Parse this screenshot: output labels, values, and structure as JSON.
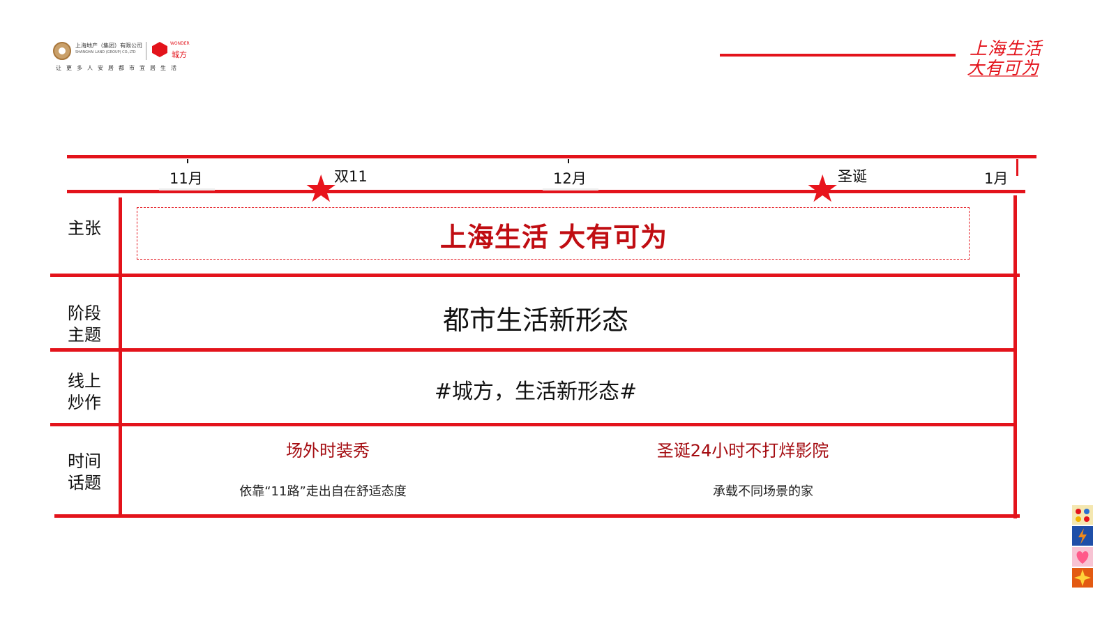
{
  "colors": {
    "accent": "#e3131b",
    "slogan": "#c00d12",
    "topic": "#a40b10"
  },
  "header": {
    "company_cn": "上海地产（集团）有限公司",
    "company_en": "SHANGHAI LAND (GROUP) CO.,LTD",
    "partner_en": "WONDER",
    "partner_cn": "城方",
    "logo_slogan": "让更多人安居都市宜居生活",
    "brand_line1": "上海生活",
    "brand_line2": "大有可为"
  },
  "timeline": {
    "months": [
      "11月",
      "12月",
      "1月"
    ],
    "events": [
      "双11",
      "圣诞"
    ],
    "event_icon": "star-icon"
  },
  "table": {
    "rows": [
      {
        "label": "主张",
        "content": "上海生活  大有可为"
      },
      {
        "label_line1": "阶段",
        "label_line2": "主题",
        "content": "都市生活新形态"
      },
      {
        "label_line1": "线上",
        "label_line2": "炒作",
        "content": "#城方，生活新形态#"
      },
      {
        "label_line1": "时间",
        "label_line2": "话题"
      }
    ],
    "topics": [
      {
        "title": "场外时装秀",
        "desc": "依靠“11路”走出自在舒适态度"
      },
      {
        "title": "圣诞24小时不打烊影院",
        "desc": "承载不同场景的家"
      }
    ]
  },
  "side_tiles": [
    "dots-icon",
    "lightning-icon",
    "heart-icon",
    "sparkle-icon"
  ]
}
